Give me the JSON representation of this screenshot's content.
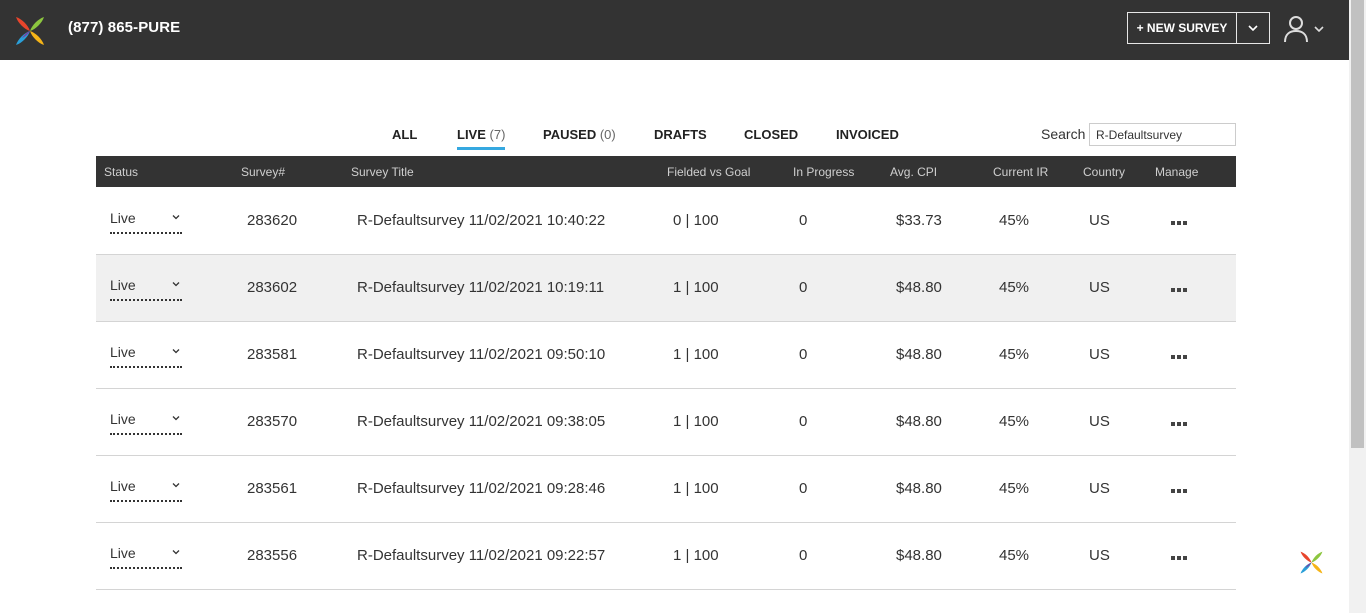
{
  "header": {
    "phone": "(877) 865-PURE",
    "new_survey_label": "+ NEW SURVEY"
  },
  "tabs": [
    {
      "label": "ALL",
      "count": ""
    },
    {
      "label": "LIVE",
      "count": "(7)"
    },
    {
      "label": "PAUSED",
      "count": "(0)"
    },
    {
      "label": "DRAFTS",
      "count": ""
    },
    {
      "label": "CLOSED",
      "count": ""
    },
    {
      "label": "INVOICED",
      "count": ""
    }
  ],
  "active_tab": "LIVE",
  "search": {
    "label": "Search",
    "value": "R-Defaultsurvey"
  },
  "table": {
    "headers": [
      "Status",
      "Survey#",
      "Survey Title",
      "Fielded vs Goal",
      "In Progress",
      "Avg. CPI",
      "Current IR",
      "Country",
      "Manage"
    ],
    "rows": [
      {
        "status": "Live",
        "survey": "283620",
        "title": "R-Defaultsurvey 11/02/2021 10:40:22",
        "fielded": "0 | 100",
        "in_progress": "0",
        "cpi": "$33.73",
        "ir": "45%",
        "country": "US"
      },
      {
        "status": "Live",
        "survey": "283602",
        "title": "R-Defaultsurvey 11/02/2021 10:19:11",
        "fielded": "1 | 100",
        "in_progress": "0",
        "cpi": "$48.80",
        "ir": "45%",
        "country": "US"
      },
      {
        "status": "Live",
        "survey": "283581",
        "title": "R-Defaultsurvey 11/02/2021 09:50:10",
        "fielded": "1 | 100",
        "in_progress": "0",
        "cpi": "$48.80",
        "ir": "45%",
        "country": "US"
      },
      {
        "status": "Live",
        "survey": "283570",
        "title": "R-Defaultsurvey 11/02/2021 09:38:05",
        "fielded": "1 | 100",
        "in_progress": "0",
        "cpi": "$48.80",
        "ir": "45%",
        "country": "US"
      },
      {
        "status": "Live",
        "survey": "283561",
        "title": "R-Defaultsurvey 11/02/2021 09:28:46",
        "fielded": "1 | 100",
        "in_progress": "0",
        "cpi": "$48.80",
        "ir": "45%",
        "country": "US"
      },
      {
        "status": "Live",
        "survey": "283556",
        "title": "R-Defaultsurvey 11/02/2021 09:22:57",
        "fielded": "1 | 100",
        "in_progress": "0",
        "cpi": "$48.80",
        "ir": "45%",
        "country": "US"
      }
    ]
  },
  "colors": {
    "topbar": "#333333",
    "tab_underline": "#35a8e0",
    "alt_row": "#f0f0f0"
  },
  "icons": {
    "logo": "pinwheel-logo-icon",
    "caret": "chevron-down-icon",
    "user": "user-icon",
    "manage": "ellipsis-icon"
  }
}
